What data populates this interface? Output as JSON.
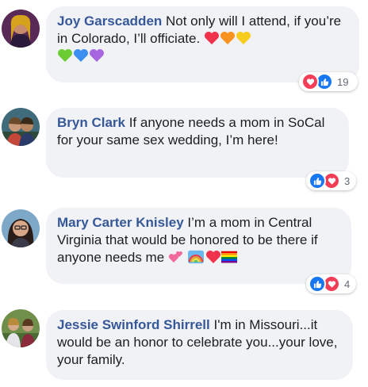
{
  "comments": [
    {
      "author": "Joy Garscadden",
      "text": " Not only will I attend, if you’re in Colorado, I’ll officiate.",
      "reactions": {
        "icons": [
          "love",
          "like"
        ],
        "count": "19"
      }
    },
    {
      "author": "Bryn Clark",
      "text": " If anyone needs a mom in SoCal for your same sex wedding, I’m here!",
      "reactions": {
        "icons": [
          "like",
          "love"
        ],
        "count": "3"
      }
    },
    {
      "author": "Mary Carter Knisley",
      "text": " I’m a mom in Central Virginia that would be honored to be there if anyone needs me",
      "reactions": {
        "icons": [
          "like",
          "love"
        ],
        "count": "4"
      }
    },
    {
      "author": "Jessie Swinford Shirrell",
      "text": " I'm in Missouri...it would be an honor to celebrate you...your love, your family."
    }
  ],
  "colors": {
    "name": "#365899",
    "bubble": "#f0f2f5",
    "like": "#1877f2",
    "love": "#f33e58"
  },
  "emojis": {
    "comment_1": [
      "red-heart",
      "orange-heart",
      "yellow-heart",
      "green-heart",
      "blue-heart",
      "purple-heart"
    ],
    "comment_3": [
      "two-hearts",
      "rainbow",
      "red-heart",
      "rainbow-flag"
    ]
  }
}
